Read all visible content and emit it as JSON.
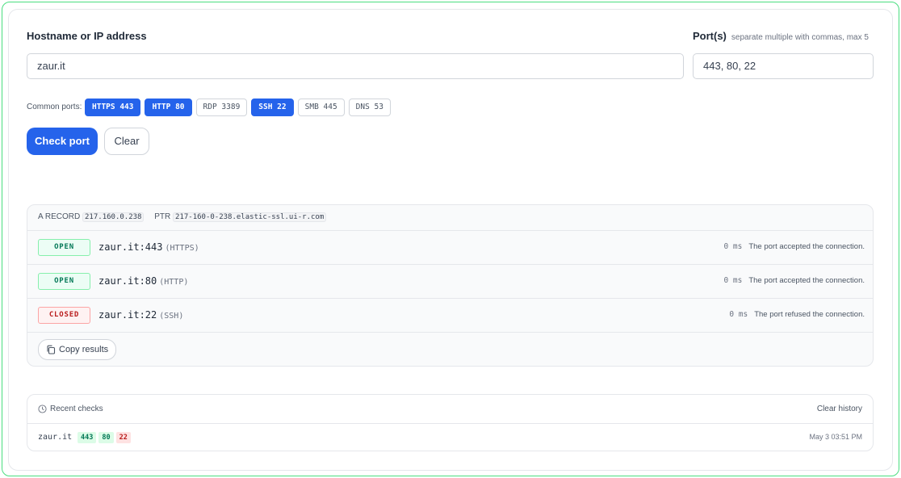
{
  "form": {
    "host_label": "Hostname or IP address",
    "port_label": "Port(s)",
    "port_hint": "separate multiple with commas, max 5",
    "host_value": "zaur.it",
    "port_value": "443, 80, 22",
    "common_ports_label": "Common ports:",
    "chips": [
      {
        "label": "HTTPS 443",
        "active": true
      },
      {
        "label": "HTTP 80",
        "active": true
      },
      {
        "label": "RDP 3389",
        "active": false
      },
      {
        "label": "SSH 22",
        "active": true
      },
      {
        "label": "SMB 445",
        "active": false
      },
      {
        "label": "DNS 53",
        "active": false
      }
    ],
    "check_label": "Check port",
    "clear_label": "Clear"
  },
  "results": {
    "a_record_label": "A RECORD",
    "a_record_value": "217.160.0.238",
    "ptr_label": "PTR",
    "ptr_value": "217-160-0-238.elastic-ssl.ui-r.com",
    "rows": [
      {
        "status": "OPEN",
        "state": "open",
        "target": "zaur.it:443",
        "service": "(HTTPS)",
        "ms": "0 ms",
        "message": "The port accepted the connection."
      },
      {
        "status": "OPEN",
        "state": "open",
        "target": "zaur.it:80",
        "service": "(HTTP)",
        "ms": "0 ms",
        "message": "The port accepted the connection."
      },
      {
        "status": "CLOSED",
        "state": "closed",
        "target": "zaur.it:22",
        "service": "(SSH)",
        "ms": "0 ms",
        "message": "The port refused the connection."
      }
    ],
    "copy_label": "Copy results"
  },
  "recent": {
    "title": "Recent checks",
    "clear_label": "Clear history",
    "items": [
      {
        "host": "zaur.it",
        "ports": [
          {
            "port": "443",
            "state": "open"
          },
          {
            "port": "80",
            "state": "open"
          },
          {
            "port": "22",
            "state": "closed"
          }
        ],
        "time": "May 3 03:51 PM"
      }
    ]
  },
  "icons": {
    "copy": "copy-icon",
    "clock": "clock-icon"
  },
  "colors": {
    "accent": "#2563eb",
    "open": "#047857",
    "closed": "#b91c1c",
    "frame": "#4ade80"
  }
}
